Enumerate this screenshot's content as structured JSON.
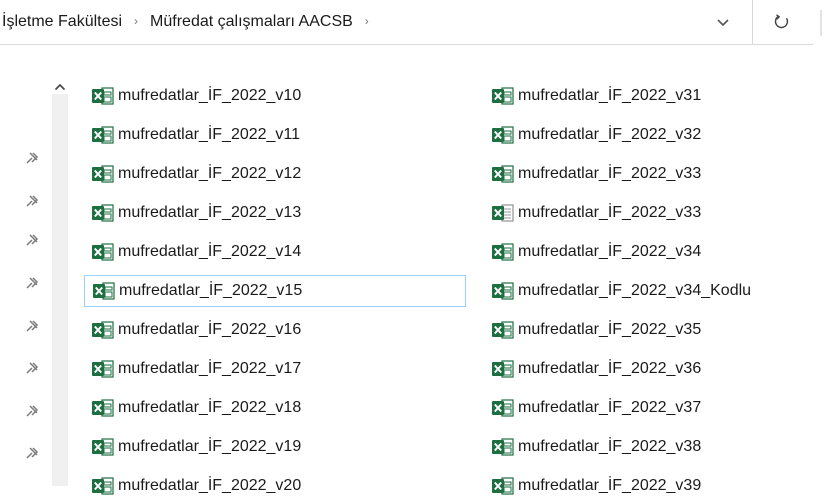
{
  "breadcrumb": {
    "items": [
      "İşletme Fakültesi",
      "Müfredat çalışmaları AACSB"
    ],
    "separator": "›"
  },
  "icons": {
    "dropdown": "chevron-down-icon",
    "refresh": "refresh-icon",
    "pin": "pin-icon",
    "scroll_up": "scroll-up-arrow-icon",
    "excel": "excel-file-icon",
    "excel_csv": "excel-csv-file-icon"
  },
  "colors": {
    "excel_green": "#1d6f42",
    "selection_border": "#99d1ff",
    "pin_gray": "#7b7b7b"
  },
  "files": {
    "col1": [
      {
        "name": "mufredatlar_İF_2022_v10",
        "icon": "excel"
      },
      {
        "name": "mufredatlar_İF_2022_v11",
        "icon": "excel"
      },
      {
        "name": "mufredatlar_İF_2022_v12",
        "icon": "excel"
      },
      {
        "name": "mufredatlar_İF_2022_v13",
        "icon": "excel"
      },
      {
        "name": "mufredatlar_İF_2022_v14",
        "icon": "excel"
      },
      {
        "name": "mufredatlar_İF_2022_v15",
        "icon": "excel",
        "selected": true
      },
      {
        "name": "mufredatlar_İF_2022_v16",
        "icon": "excel"
      },
      {
        "name": "mufredatlar_İF_2022_v17",
        "icon": "excel"
      },
      {
        "name": "mufredatlar_İF_2022_v18",
        "icon": "excel"
      },
      {
        "name": "mufredatlar_İF_2022_v19",
        "icon": "excel"
      },
      {
        "name": "mufredatlar_İF_2022_v20",
        "icon": "excel"
      }
    ],
    "col2": [
      {
        "name": "mufredatlar_İF_2022_v31",
        "icon": "excel"
      },
      {
        "name": "mufredatlar_İF_2022_v32",
        "icon": "excel"
      },
      {
        "name": "mufredatlar_İF_2022_v33",
        "icon": "excel"
      },
      {
        "name": "mufredatlar_İF_2022_v33",
        "icon": "excel_csv"
      },
      {
        "name": "mufredatlar_İF_2022_v34",
        "icon": "excel"
      },
      {
        "name": "mufredatlar_İF_2022_v34_Kodlu",
        "icon": "excel"
      },
      {
        "name": "mufredatlar_İF_2022_v35",
        "icon": "excel"
      },
      {
        "name": "mufredatlar_İF_2022_v36",
        "icon": "excel"
      },
      {
        "name": "mufredatlar_İF_2022_v37",
        "icon": "excel"
      },
      {
        "name": "mufredatlar_İF_2022_v38",
        "icon": "excel"
      },
      {
        "name": "mufredatlar_İF_2022_v39",
        "icon": "excel"
      }
    ]
  }
}
